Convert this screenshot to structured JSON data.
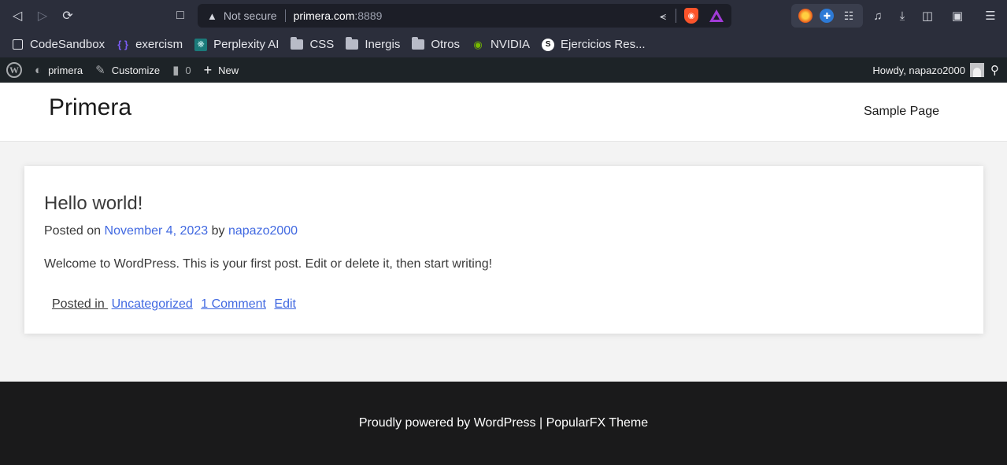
{
  "browser": {
    "url": {
      "security_label": "Not secure",
      "host": "primera.com",
      "port": ":8889"
    }
  },
  "bookmarks": [
    {
      "label": "CodeSandbox",
      "icon": "box-icon"
    },
    {
      "label": "exercism",
      "icon": "exercism-icon"
    },
    {
      "label": "Perplexity AI",
      "icon": "perplexity-icon"
    },
    {
      "label": "CSS",
      "icon": "folder-icon"
    },
    {
      "label": "Inergis",
      "icon": "folder-icon"
    },
    {
      "label": "Otros",
      "icon": "folder-icon"
    },
    {
      "label": "NVIDIA",
      "icon": "nvidia-icon"
    },
    {
      "label": "Ejercicios Res...",
      "icon": "ejercicios-icon"
    }
  ],
  "adminbar": {
    "site_label": "primera",
    "customize_label": "Customize",
    "comments_count": "0",
    "new_label": "New",
    "howdy_label": "Howdy, napazo2000"
  },
  "site": {
    "title": "Primera",
    "nav": {
      "sample_page": "Sample Page"
    }
  },
  "post": {
    "title": "Hello world!",
    "meta": {
      "posted_on_prefix": "Posted on",
      "date": "November 4, 2023",
      "by_prefix": "by",
      "author": "napazo2000"
    },
    "body": "Welcome to WordPress. This is your first post. Edit or delete it, then start writing!",
    "footer": {
      "posted_in_prefix": "Posted in",
      "category": "Uncategorized",
      "comments": "1 Comment",
      "edit": "Edit"
    }
  },
  "footer": {
    "text": "Proudly powered by WordPress | PopularFX Theme"
  },
  "colors": {
    "link": "#4169e1",
    "adminbar_bg": "#1d2327",
    "footer_bg": "#1a1a1b"
  }
}
